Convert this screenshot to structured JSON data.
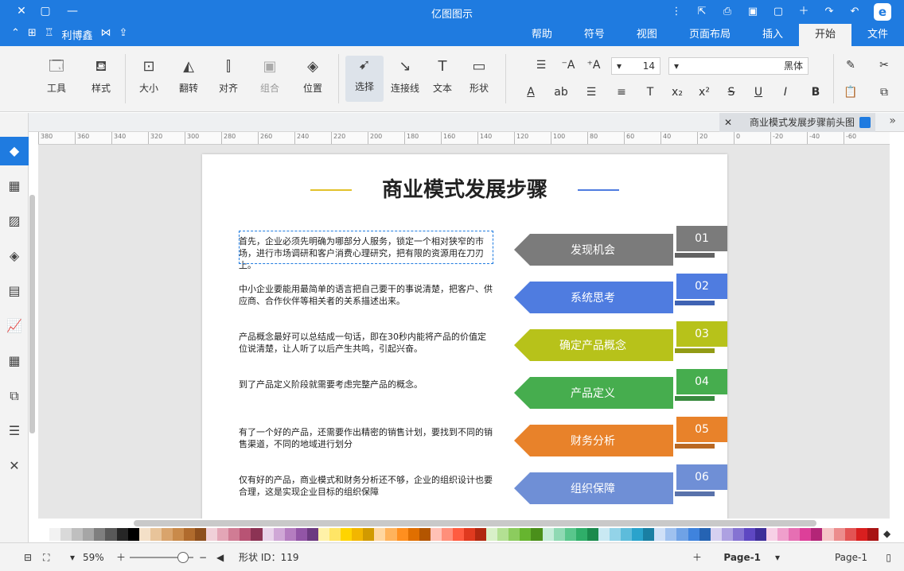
{
  "window": {
    "title": "亿图图示"
  },
  "titlebar_actions": [
    "undo-icon",
    "redo-icon",
    "new-icon",
    "open-icon",
    "save-icon",
    "print-icon",
    "export-icon",
    "more-icon"
  ],
  "tabs": [
    "文件",
    "开始",
    "插入",
    "页面布局",
    "视图",
    "符号",
    "帮助"
  ],
  "active_tab": "开始",
  "left_header": {
    "publish_label": "发布",
    "share": "利博鑫"
  },
  "ribbon": {
    "font_name": "黑体",
    "font_size": "14",
    "buttons": {
      "shape": "形状",
      "text": "文本",
      "connector": "连接线",
      "select": "选择",
      "position": "位置",
      "group": "组合",
      "align": "对齐",
      "flip": "翻转",
      "size": "大小",
      "style": "样式",
      "tools": "工具"
    },
    "format_small": [
      "B",
      "I",
      "U",
      "S",
      "x²",
      "x₂",
      "T",
      "≡",
      "☰",
      "ab",
      "A"
    ]
  },
  "document": {
    "tab_title": "商业模式发展步骤前头图"
  },
  "ruler_labels": [
    "380",
    "360",
    "340",
    "320",
    "300",
    "280",
    "260",
    "240",
    "220",
    "200",
    "180",
    "160",
    "140",
    "120",
    "100",
    "80",
    "60",
    "40",
    "20",
    "0",
    "-20",
    "-40",
    "-60"
  ],
  "diagram": {
    "title": "商业模式发展步骤",
    "steps": [
      {
        "num": "01",
        "label": "发现机会",
        "color": "#7b7b7b",
        "desc": "首先，企业必须先明确为哪部分人服务，锁定一个相对狭窄的市场，进行市场调研和客户消费心理研究，把有限的资源用在刀刃上。"
      },
      {
        "num": "02",
        "label": "系统思考",
        "color": "#4f7ce0",
        "desc": "中小企业要能用最简单的语言把自己要干的事说清楚，把客户、供应商、合作伙伴等相关者的关系描述出来。"
      },
      {
        "num": "03",
        "label": "确定产品概念",
        "color": "#b7c21a",
        "desc": "产品概念最好可以总结成一句话，即在30秒内能将产品的价值定位说清楚，让人听了以后产生共鸣，引起兴奋。"
      },
      {
        "num": "04",
        "label": "产品定义",
        "color": "#46ad4e",
        "desc": "到了产品定义阶段就需要考虑完整产品的概念。"
      },
      {
        "num": "05",
        "label": "财务分析",
        "color": "#e8822a",
        "desc": "有了一个好的产品，还需要作出精密的销售计划，要找到不同的销售渠道，不同的地域进行划分"
      },
      {
        "num": "06",
        "label": "组织保障",
        "color": "#6f8fd6",
        "desc": "仅有好的产品，商业模式和财务分析还不够，企业的组织设计也要合理，这是实现企业目标的组织保障"
      }
    ]
  },
  "palette": [
    "#ffffff",
    "#f2f2f2",
    "#d9d9d9",
    "#bfbfbf",
    "#a6a6a6",
    "#7f7f7f",
    "#595959",
    "#262626",
    "#000000",
    "#f4e0c8",
    "#e8c49a",
    "#d9a46c",
    "#c98a4a",
    "#b06b2d",
    "#8e4f1d",
    "#f0d0d8",
    "#e3a6b6",
    "#d07c94",
    "#b85374",
    "#8c3354",
    "#e8d3ea",
    "#cfa7d6",
    "#b47dc0",
    "#9255a6",
    "#6c3a80",
    "#fff2a8",
    "#ffe566",
    "#ffd400",
    "#f2b600",
    "#d19a00",
    "#ffd6a0",
    "#ffb35c",
    "#ff8f1f",
    "#e06f00",
    "#b35500",
    "#ffc1b5",
    "#ff8f7a",
    "#ff5c40",
    "#e03a1f",
    "#b02810",
    "#d8f0c8",
    "#b3e093",
    "#8ccc5e",
    "#66b52f",
    "#4a8f1a",
    "#c5ecd9",
    "#8fd9b3",
    "#59c68c",
    "#2fae69",
    "#1a8a4d",
    "#c9e9f3",
    "#93d3e8",
    "#5dbcdb",
    "#2aa3cc",
    "#1a7fa3",
    "#cfe0f7",
    "#9fc1ef",
    "#6fa2e6",
    "#3f83dd",
    "#2563b3",
    "#d6d0f0",
    "#ada1e1",
    "#8573d2",
    "#5e47c2",
    "#3f2e99",
    "#f7d0e6",
    "#ef9fcc",
    "#e66fb3",
    "#dd3f99",
    "#b32577",
    "#f5c6c6",
    "#ec8d8d",
    "#e35454",
    "#d91f1f",
    "#a81414"
  ],
  "status": {
    "page_label": "Page-1",
    "page_current": "Page-1",
    "shape_id": "形状 ID：119",
    "zoom": "59%"
  }
}
